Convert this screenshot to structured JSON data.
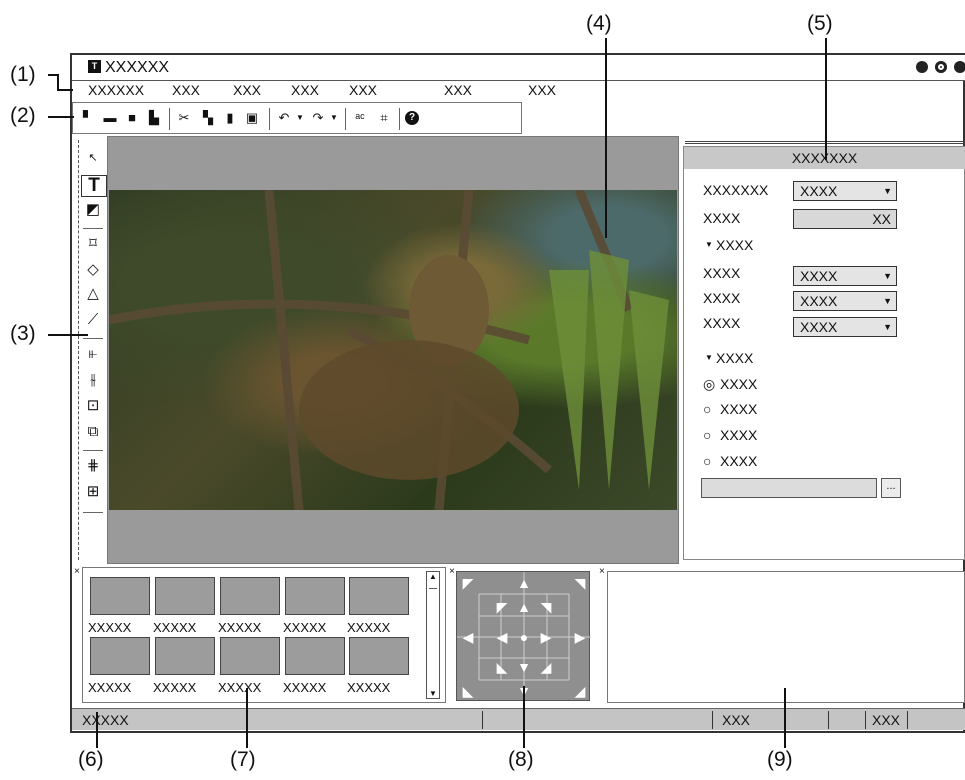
{
  "callouts": [
    "(1)",
    "(2)",
    "(3)",
    "(4)",
    "(5)",
    "(6)",
    "(7)",
    "(8)",
    "(9)"
  ],
  "window": {
    "title": "XXXXXX",
    "logo_letter": "T"
  },
  "menu": [
    "XXXXXX",
    "XXX",
    "XXX",
    "XXX",
    "XXX",
    "XXX",
    "XXX"
  ],
  "toolbar_icons": [
    "new-icon",
    "open-icon",
    "save-icon",
    "save-as-icon",
    "cut-icon",
    "copy-icon",
    "paste-icon",
    "delete-icon",
    "undo-icon",
    "redo-icon",
    "find-replace-icon",
    "capture-icon",
    "help-icon"
  ],
  "left_tools": [
    "pointer-icon",
    "text-icon",
    "image-icon",
    "rectangle-icon",
    "ellipse-icon",
    "polygon-icon",
    "line-icon",
    "align-icon",
    "distribute-icon",
    "center-icon",
    "order-icon",
    "grid-icon",
    "safe-area-icon"
  ],
  "properties": {
    "header": "XXXXXXX",
    "row1_label": "XXXXXXX",
    "row1_value": "XXXX",
    "row2_label": "XXXX",
    "row2_value": "XX",
    "group1_title": "XXXX",
    "group1_rows": [
      {
        "label": "XXXX",
        "value": "XXXX"
      },
      {
        "label": "XXXX",
        "value": "XXXX"
      },
      {
        "label": "XXXX",
        "value": "XXXX"
      }
    ],
    "group2_title": "XXXX",
    "radios": [
      "XXXX",
      "XXXX",
      "XXXX",
      "XXXX"
    ],
    "browse_label": "..."
  },
  "thumbnails": {
    "row1": [
      "XXXXX",
      "XXXXX",
      "XXXXX",
      "XXXXX",
      "XXXXX"
    ],
    "row2": [
      "XXXXX",
      "XXXXX",
      "XXXXX",
      "XXXXX",
      "XXXXX"
    ]
  },
  "status": {
    "left": "XXXXX",
    "mid": "XXX",
    "right": "XXX"
  }
}
